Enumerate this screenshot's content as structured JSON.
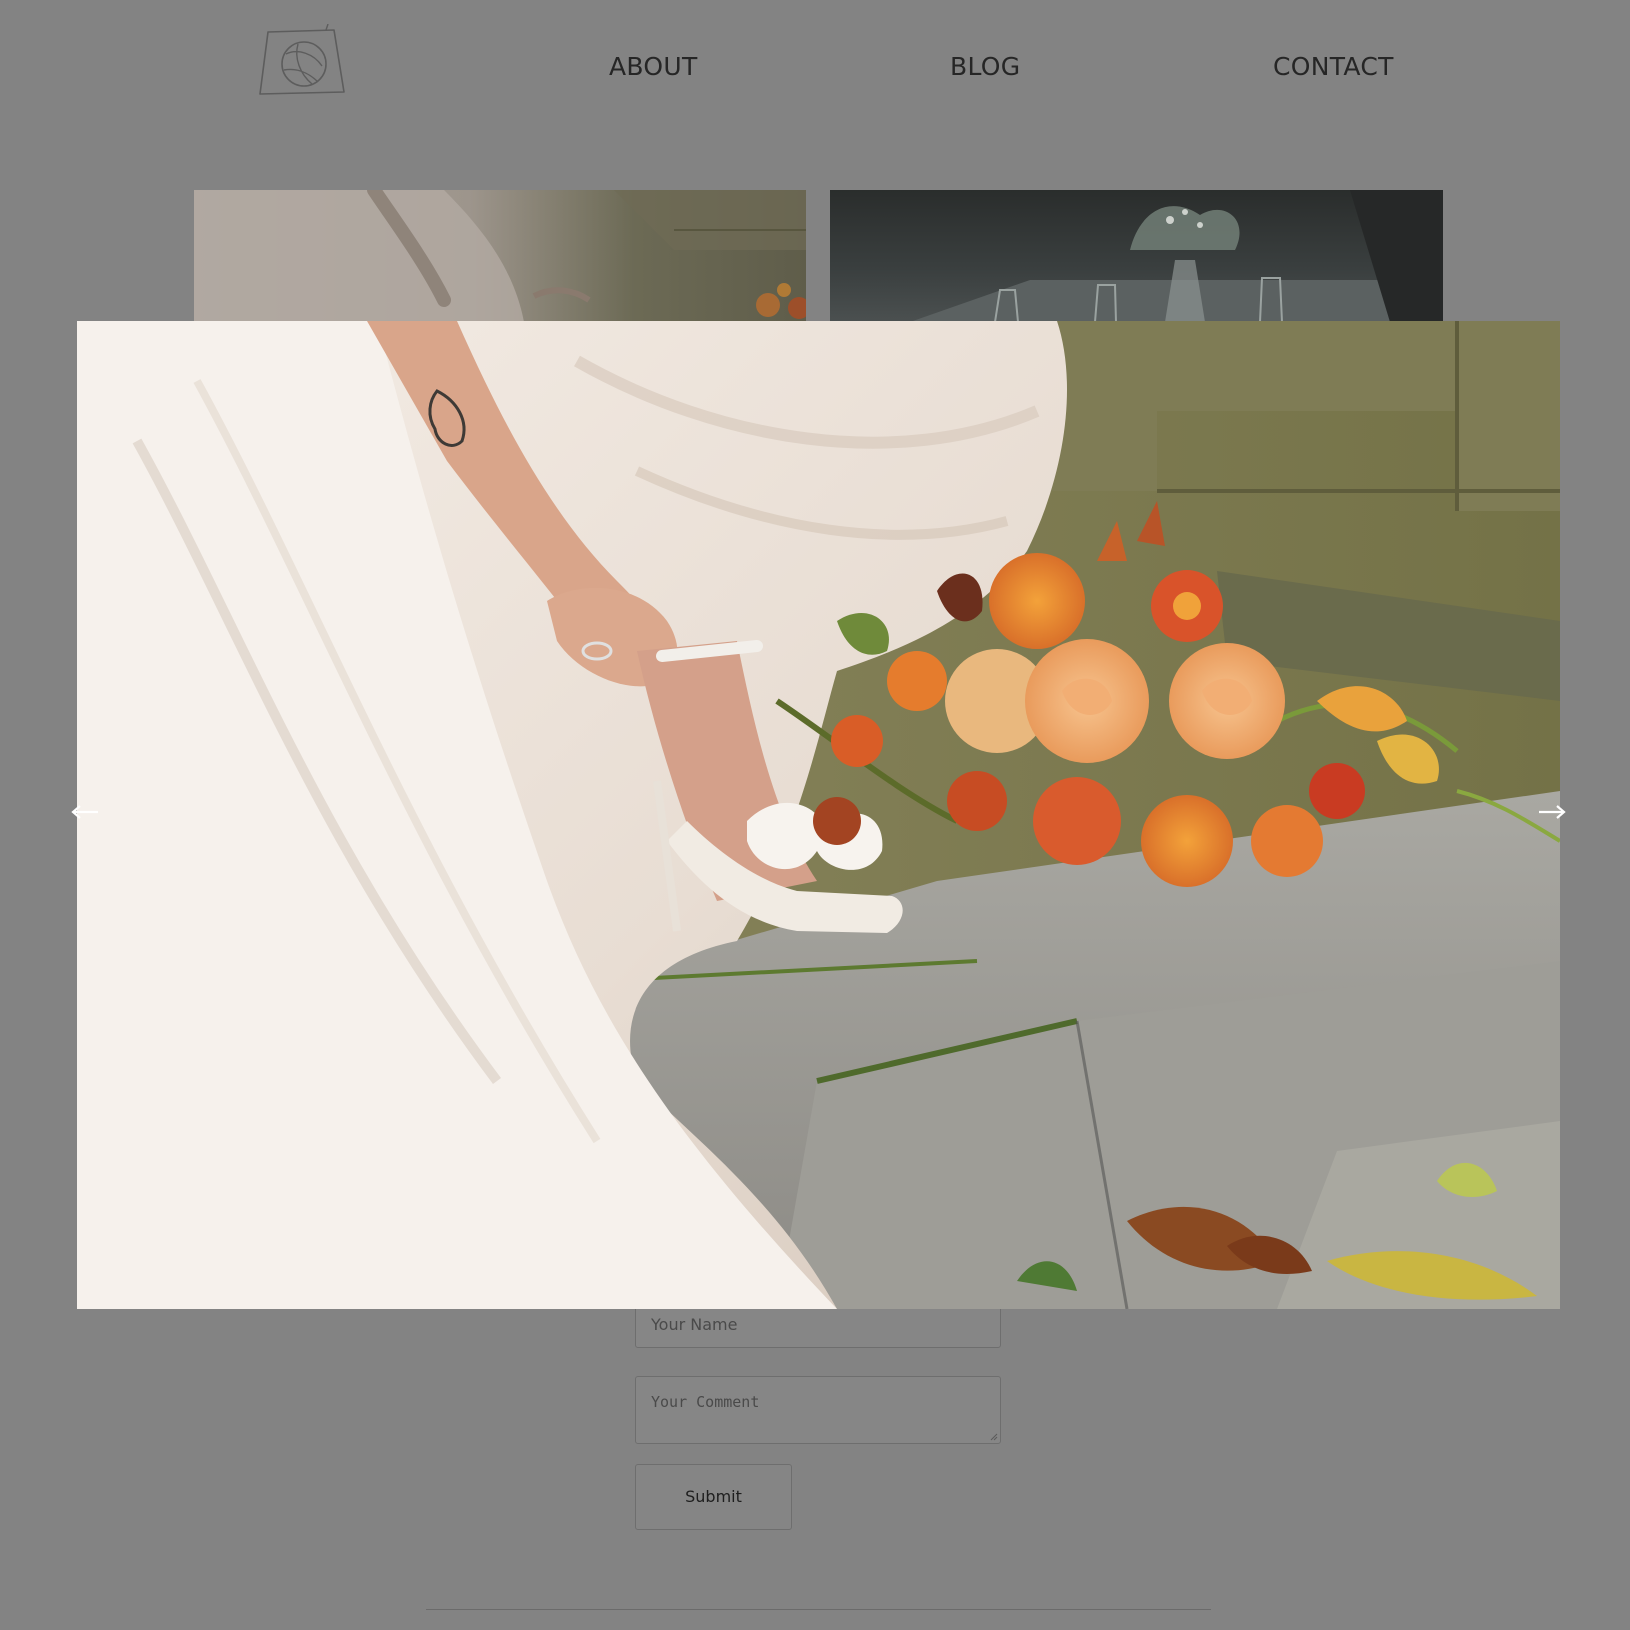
{
  "header": {
    "logo_icon": "sketch-logo-icon",
    "nav": {
      "about": "ABOUT",
      "blog": "BLOG",
      "contact": "CONTACT"
    }
  },
  "gallery": {
    "thumbnails": [
      {
        "subject": "bride-shoe-bouquet"
      },
      {
        "subject": "table-glassware-flowers"
      }
    ]
  },
  "lightbox": {
    "image_subject": "bride fastening sandal beside orange rose bouquet on stone step",
    "prev_icon": "arrow-left-icon",
    "next_icon": "arrow-right-icon"
  },
  "comment_form": {
    "name_placeholder": "Your Name",
    "comment_placeholder": "Your Comment",
    "submit_label": "Submit"
  },
  "colors": {
    "overlay_background": "#838383",
    "nav_text": "#262626",
    "arrow": "#ffffff"
  }
}
